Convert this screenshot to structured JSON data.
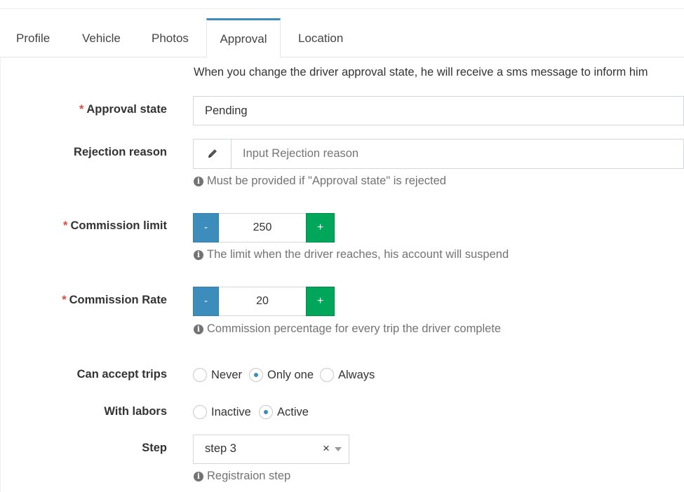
{
  "tabs": [
    {
      "label": "Profile",
      "active": false
    },
    {
      "label": "Vehicle",
      "active": false
    },
    {
      "label": "Photos",
      "active": false
    },
    {
      "label": "Approval",
      "active": true
    },
    {
      "label": "Location",
      "active": false
    }
  ],
  "notice": "When you change the driver approval state, he will receive a sms message to inform him",
  "approval_state": {
    "required_mark": "*",
    "label": "Approval state",
    "value": "Pending"
  },
  "rejection_reason": {
    "label": "Rejection reason",
    "placeholder": "Input Rejection reason",
    "value": "",
    "icon": "pencil-icon",
    "help": "Must be provided if \"Approval state\" is rejected"
  },
  "commission_limit": {
    "required_mark": "*",
    "label": "Commission limit",
    "minus": "-",
    "plus": "+",
    "value": "250",
    "help": "The limit when the driver reaches, his account will suspend"
  },
  "commission_rate": {
    "required_mark": "*",
    "label": "Commission Rate",
    "minus": "-",
    "plus": "+",
    "value": "20",
    "help": "Commission percentage for every trip the driver complete"
  },
  "can_accept_trips": {
    "label": "Can accept trips",
    "options": [
      "Never",
      "Only one",
      "Always"
    ],
    "selected": "Only one"
  },
  "with_labors": {
    "label": "With labors",
    "options": [
      "Inactive",
      "Active"
    ],
    "selected": "Active"
  },
  "step": {
    "label": "Step",
    "value": "step 3",
    "clear": "×",
    "help": "Registraion step"
  },
  "colors": {
    "primary": "#3c8dbc",
    "success": "#00a65a",
    "required": "#dd4b39",
    "help_text": "#737373"
  }
}
